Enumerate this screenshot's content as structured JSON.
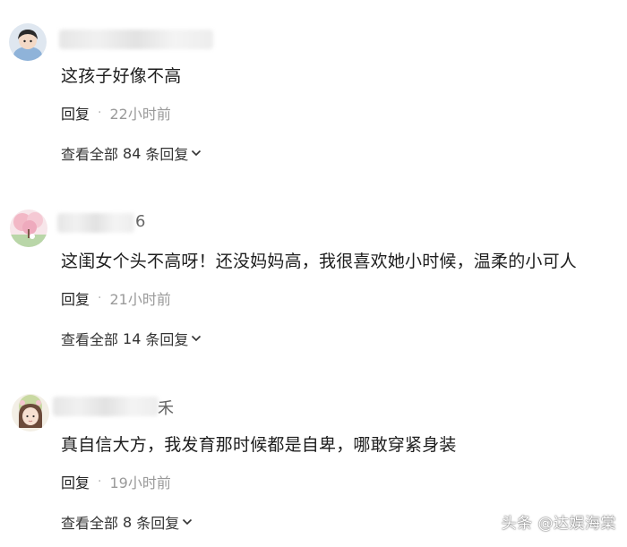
{
  "comments": [
    {
      "username_suffix": "",
      "text": "这孩子好像不高",
      "reply_label": "回复",
      "separator": "·",
      "time": "22小时前",
      "view_all_prefix": "查看全部",
      "view_all_count": "84",
      "view_all_suffix": "条回复"
    },
    {
      "username_suffix": "6",
      "text": "这闺女个头不高呀！还没妈妈高，我很喜欢她小时候，温柔的小可人",
      "reply_label": "回复",
      "separator": "·",
      "time": "21小时前",
      "view_all_prefix": "查看全部",
      "view_all_count": "14",
      "view_all_suffix": "条回复"
    },
    {
      "username_suffix": "禾",
      "text": "真自信大方，我发育那时候都是自卑，哪敢穿紧身装",
      "reply_label": "回复",
      "separator": "·",
      "time": "19小时前",
      "view_all_prefix": "查看全部",
      "view_all_count": "8",
      "view_all_suffix": "条回复"
    }
  ],
  "icons": {
    "expand": "chevron-down-icon"
  },
  "watermark": "头条 @达娱海棠"
}
